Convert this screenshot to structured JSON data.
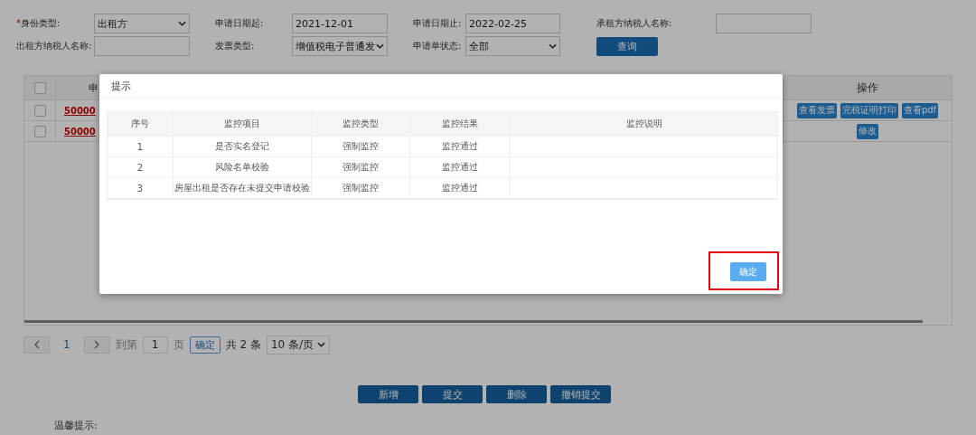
{
  "filters": [
    {
      "label": "身份类型:",
      "required_mark": "*",
      "kind": "select",
      "value": "出租方"
    },
    {
      "label": "申请日期起:",
      "kind": "input",
      "value": "2021-12-01"
    },
    {
      "label": "申请日期止:",
      "kind": "input",
      "value": "2022-02-25"
    },
    {
      "label": "承租方纳税人名称:",
      "kind": "input"
    },
    {
      "label": "出租方纳税人名称:",
      "kind": "input"
    },
    {
      "label": "发票类型:",
      "kind": "select",
      "value": "增值税电子普通发"
    },
    {
      "label": "申请单状态:",
      "kind": "select",
      "value": "全部"
    }
  ],
  "query_button": "查询",
  "table": {
    "header_checked": false,
    "columns": [
      "申",
      "操作"
    ],
    "rows": [
      {
        "checked": false,
        "link": "50000",
        "actions": [
          "查看发票",
          "完税证明打印",
          "查看pdf"
        ]
      },
      {
        "checked": false,
        "link": "50000",
        "actions": [
          "修改"
        ]
      }
    ]
  },
  "pagination": {
    "current_page": "1",
    "goto_label": "到第",
    "page_input": "1",
    "page_unit": "页",
    "confirm": "确定",
    "total": "共 2 条",
    "page_size": "10 条/页"
  },
  "buttons": [
    "新增",
    "提交",
    "删除",
    "撤销提交"
  ],
  "tip_label": "温馨提示:",
  "dialog": {
    "title": "提示",
    "columns": [
      "序号",
      "监控项目",
      "监控类型",
      "监控结果",
      "监控说明"
    ],
    "rows": [
      [
        "1",
        "是否实名登记",
        "强制监控",
        "监控通过"
      ],
      [
        "2",
        "风险名单校验",
        "强制监控",
        "监控通过"
      ],
      [
        "3",
        "房屋出租是否存在未提交申请校验",
        "强制监控",
        "监控通过"
      ]
    ],
    "confirm": "确定",
    "confirm_highlighted": true
  }
}
